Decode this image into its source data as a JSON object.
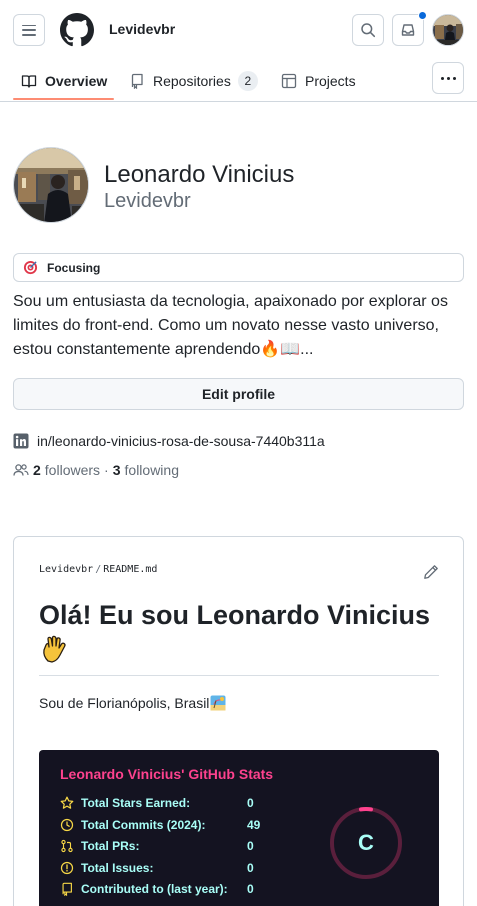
{
  "header": {
    "username": "Levidevbr",
    "icons": [
      "hamburger-icon",
      "github-logo-icon",
      "search-icon",
      "inbox-icon"
    ],
    "notification_color": "#0969da"
  },
  "tabs": [
    {
      "label": "Overview",
      "icon": "book-icon",
      "active": true
    },
    {
      "label": "Repositories",
      "icon": "repo-icon",
      "count": "2"
    },
    {
      "label": "Projects",
      "icon": "table-icon"
    }
  ],
  "profile": {
    "full_name": "Leonardo Vinicius",
    "login": "Levidevbr",
    "status": {
      "emoji": "dart-icon",
      "text": "Focusing"
    },
    "bio": "Sou um entusiasta da tecnologia, apaixonado por explorar os limites do front-end. Como um novato nesse vasto universo, estou constantemente aprendendo🔥📖...",
    "edit_button": "Edit profile",
    "linkedin": "in/leonardo-vinicius-rosa-de-sousa-7440b311a",
    "followers_count": "2",
    "followers_label": "followers",
    "following_count": "3",
    "following_label": "following",
    "separator": "·"
  },
  "readme": {
    "owner": "Levidevbr",
    "separator": "/",
    "file": "README.md",
    "heading": "Olá! Eu sou Leonardo Vinicius",
    "heading_emoji": "waving-hand-icon",
    "paragraph": "Sou de Florianópolis, Brasil",
    "paragraph_emoji": "beach-icon"
  },
  "stats": {
    "title": "Leonardo Vinicius' GitHub Stats",
    "rows": [
      {
        "icon": "star-icon",
        "label": "Total Stars Earned:",
        "value": "0"
      },
      {
        "icon": "clock-icon",
        "label": "Total Commits (2024):",
        "value": "49"
      },
      {
        "icon": "pull-request-icon",
        "label": "Total PRs:",
        "value": "0"
      },
      {
        "icon": "issue-icon",
        "label": "Total Issues:",
        "value": "0"
      },
      {
        "icon": "repo-icon",
        "label": "Contributed to (last year):",
        "value": "0"
      }
    ],
    "rank": "C",
    "colors": {
      "background": "#141321",
      "title": "#fe428e",
      "text": "#a9fef7",
      "icon": "#f8d847"
    }
  },
  "colors": {
    "accent_underline": "#fd8c73",
    "border": "#d0d7de",
    "muted": "#636c76"
  }
}
